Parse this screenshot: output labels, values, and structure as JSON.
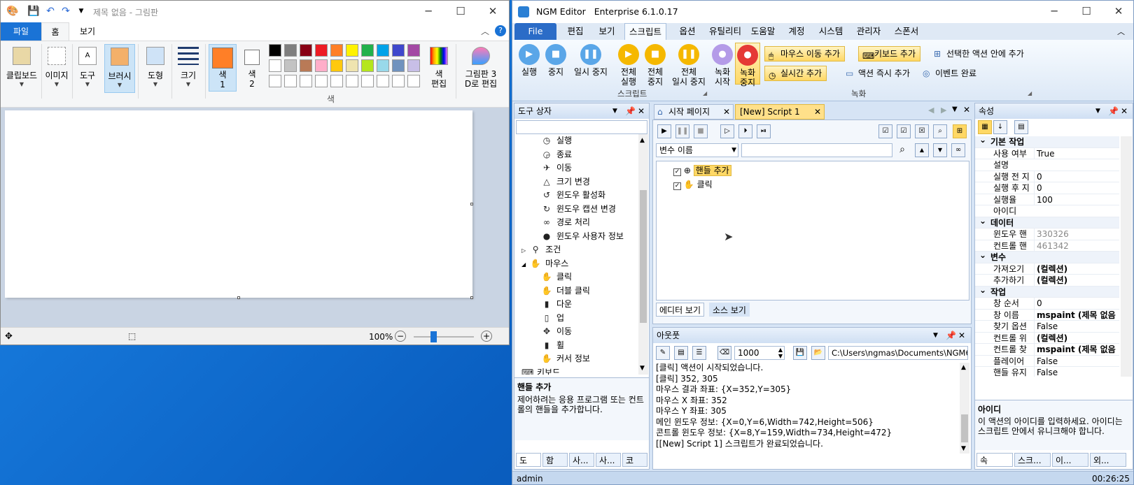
{
  "paint": {
    "title": "제목 없음 - 그림판",
    "tabs": [
      "파일",
      "홈",
      "보기"
    ],
    "groups": {
      "clipboard": "클립보드",
      "image": "이미지",
      "tools": "도구",
      "brush": "브러시",
      "shapes": "도형",
      "size": "크기",
      "color1_a": "색",
      "color1_b": "1",
      "color2_a": "색",
      "color2_b": "2",
      "edit_colors_a": "색",
      "edit_colors_b": "편집",
      "paint3d_a": "그림판 3",
      "paint3d_b": "D로 편집",
      "colors_label": "색"
    },
    "palette_row1": [
      "#000000",
      "#7f7f7f",
      "#880015",
      "#ed1c24",
      "#ff7f27",
      "#fff200",
      "#22b14c",
      "#00a2e8",
      "#3f48cc",
      "#a349a4"
    ],
    "palette_row2": [
      "#ffffff",
      "#c3c3c3",
      "#b97a57",
      "#ffaec9",
      "#ffc90e",
      "#efe4b0",
      "#b5e61d",
      "#99d9ea",
      "#7092be",
      "#c8bfe7"
    ],
    "color1": "#ff7f27",
    "zoom": "100%",
    "zoom_fraction": 0.5
  },
  "ngm": {
    "title": "NGM Editor   Enterprise 6.1.0.17",
    "menu": [
      "File",
      "편집",
      "보기",
      "스크립트",
      "옵션",
      "유틸리티",
      "도움말",
      "계정",
      "시스템",
      "관리자",
      "스폰서"
    ],
    "ribbon": {
      "run": "실행",
      "stop": "중지",
      "pause": "일시 중지",
      "run_all_a": "전체",
      "run_all_b": "실행",
      "stop_all_a": "전체",
      "stop_all_b": "중지",
      "pause_all_a": "전체",
      "pause_all_b": "일시 중지",
      "rec_start_a": "녹화",
      "rec_start_b": "시작",
      "rec_stop_a": "녹화",
      "rec_stop_b": "중지",
      "add_mouse": "마우스 이동 추가",
      "add_key": "키보드 추가",
      "add_in_selected": "선택한 액션 안에 추가",
      "add_realtime": "실시간 추가",
      "add_action_now": "액션 즉시 추가",
      "event_done": "이벤트 완료",
      "group_script": "스크립트",
      "group_record": "녹화"
    },
    "toolbox": {
      "title": "도구 상자",
      "items": [
        {
          "label": "실행",
          "icon": "◷",
          "indent": 2
        },
        {
          "label": "종료",
          "icon": "◶",
          "indent": 2
        },
        {
          "label": "이동",
          "icon": "✈",
          "indent": 2
        },
        {
          "label": "크기 변경",
          "icon": "△",
          "indent": 2
        },
        {
          "label": "윈도우 활성화",
          "icon": "↺",
          "indent": 2
        },
        {
          "label": "윈도우 캡션 변경",
          "icon": "↻",
          "indent": 2
        },
        {
          "label": "경로 처리",
          "icon": "∞",
          "indent": 2
        },
        {
          "label": "윈도우 사용자 정보",
          "icon": "●",
          "indent": 2
        },
        {
          "label": "조건",
          "icon": "⚲",
          "indent": 1,
          "expander": "▷"
        },
        {
          "label": "마우스",
          "icon": "✋",
          "indent": 1,
          "expander": "◢"
        },
        {
          "label": "클릭",
          "icon": "✋",
          "indent": 2
        },
        {
          "label": "더블 클릭",
          "icon": "✋",
          "indent": 2
        },
        {
          "label": "다운",
          "icon": "▮",
          "indent": 2
        },
        {
          "label": "업",
          "icon": "▯",
          "indent": 2
        },
        {
          "label": "이동",
          "icon": "✥",
          "indent": 2
        },
        {
          "label": "휠",
          "icon": "▮",
          "indent": 2
        },
        {
          "label": "커서 정보",
          "icon": "✋",
          "indent": 2
        },
        {
          "label": "키보드",
          "icon": "⌨",
          "indent": 1
        }
      ],
      "help_title": "핸들 추가",
      "help_text": "제어하려는 응용 프로그램 또는 컨트롤의 핸들을 추가합니다.",
      "bottom_tabs": [
        "도",
        "함",
        "사...",
        "사...",
        "코"
      ]
    },
    "doc_tabs": [
      "시작 페이지",
      "[New] Script 1"
    ],
    "var_select": "변수 이름",
    "script_items": [
      {
        "label": "핸들 추가",
        "selected": true
      },
      {
        "label": "클릭",
        "selected": false
      }
    ],
    "view_tabs": [
      "에디터 보기",
      "소스 보기"
    ],
    "output": {
      "title": "아웃풋",
      "count": "1000",
      "path": "C:\\Users\\ngmas\\Documents\\NGM6\\",
      "lines": [
        "[클릭] 액션이 시작되었습니다.",
        "[클릭] 352, 305",
        "마우스 결과 좌표: {X=352,Y=305}",
        "마우스 X 좌표: 352",
        "마우스 Y 좌표: 305",
        "메인 윈도우 정보: {X=0,Y=6,Width=742,Height=506}",
        "콘트롤 윈도우 정보: {X=8,Y=159,Width=734,Height=472}",
        "[[New] Script 1] 스크립트가 완료되었습니다."
      ]
    },
    "props": {
      "title": "속성",
      "rows": [
        {
          "cat": true,
          "k": "기본 작업"
        },
        {
          "k": "사용 여부",
          "v": "True"
        },
        {
          "k": "설명",
          "v": ""
        },
        {
          "k": "실행 전 지",
          "v": "0"
        },
        {
          "k": "실행 후 지",
          "v": "0"
        },
        {
          "k": "실행율",
          "v": "100"
        },
        {
          "k": "아이디",
          "v": ""
        },
        {
          "cat": true,
          "k": "데이터"
        },
        {
          "k": "윈도우 핸",
          "v": "330326",
          "dim": true
        },
        {
          "k": "컨트롤 핸",
          "v": "461342",
          "dim": true
        },
        {
          "cat": true,
          "k": "변수"
        },
        {
          "k": "가져오기",
          "v": "(컬렉션)",
          "bold": true
        },
        {
          "k": "추가하기",
          "v": "(컬렉션)",
          "bold": true
        },
        {
          "cat": true,
          "k": "작업"
        },
        {
          "k": "창 순서",
          "v": "0"
        },
        {
          "k": "창 이름",
          "v": "mspaint (제목 없음",
          "bold": true
        },
        {
          "k": "찾기 옵션",
          "v": "False"
        },
        {
          "k": "컨트롤 위",
          "v": "(컬렉션)",
          "bold": true
        },
        {
          "k": "컨트롤 찾",
          "v": "mspaint (제목 없음",
          "bold": true
        },
        {
          "k": "플레이어",
          "v": "False"
        },
        {
          "k": "핸들 유지",
          "v": "False"
        }
      ],
      "help_title": "아이디",
      "help_text": "이 액션의 아이디를 입력하세요. 아이디는 스크립트 안에서 유니크해야 합니다.",
      "bottom_tabs": [
        "속",
        "스크...",
        "이...",
        "외..."
      ]
    },
    "status": {
      "user": "admin",
      "time": "00:26:25"
    }
  }
}
